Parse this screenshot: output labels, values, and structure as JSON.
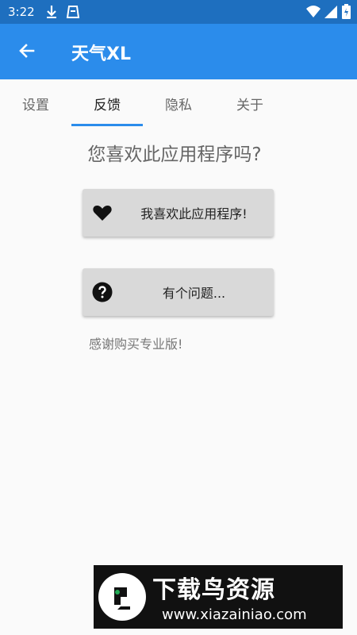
{
  "status_bar": {
    "time": "3:22",
    "icons": [
      "download-icon",
      "notification-box-icon",
      "wifi-icon",
      "signal-icon",
      "battery-icon"
    ]
  },
  "app_bar": {
    "title": "天气XL",
    "back_icon": "arrow-back-icon",
    "color": "#2b8ceb"
  },
  "tabs": {
    "items": [
      "设置",
      "反馈",
      "隐私",
      "关于"
    ],
    "selected": "反馈",
    "indicator_color": "#2b8ceb"
  },
  "main": {
    "question": "您喜欢此应用程序吗?",
    "like_button": {
      "label": "我喜欢此应用程序!",
      "icon": "heart-icon"
    },
    "problem_button": {
      "label": "有个问题...",
      "icon": "help-circle-icon"
    },
    "thanks": "感谢购买专业版!"
  },
  "watermark": {
    "title": "下载鸟资源",
    "url": "www.xiazainiao.com"
  }
}
